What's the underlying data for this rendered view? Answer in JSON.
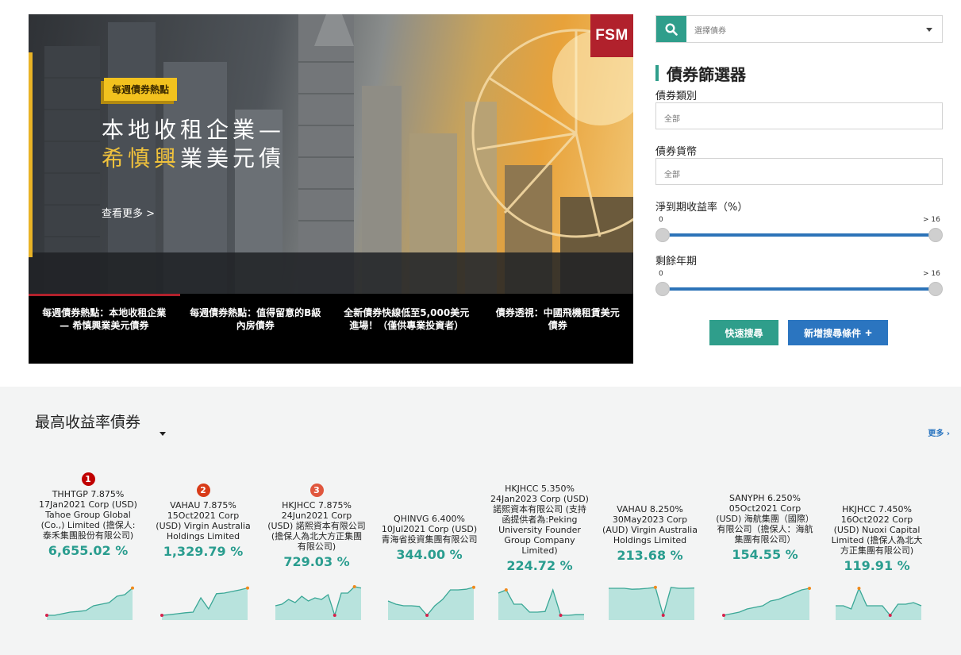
{
  "hero": {
    "logo": "FSM",
    "tag": "每週債券熱點",
    "title_line1": "本地收租企業—",
    "title_line2_a": "希慎興",
    "title_line2_b": "業",
    "title_line2_c": "美元債",
    "more": "查看更多 >",
    "nav": [
      "每週債券熱點：本地收租企業 — 希慎興業美元債券",
      "每週債券熱點：值得留意的B級內房債券",
      "全新債券快線低至5,000美元進場！（僅供專業投資者）",
      "債券透視：中國飛機租賃美元債券"
    ]
  },
  "search": {
    "placeholder": "選擇債券",
    "icon": "search-icon"
  },
  "filter": {
    "title": "債券篩選器",
    "type_label": "債券類別",
    "type_value": "全部",
    "currency_label": "債券貨幣",
    "currency_value": "全部",
    "ytm_label": "淨到期收益率（%）",
    "ytm_min": "0",
    "ytm_max": "> 16",
    "tenor_label": "剩餘年期",
    "tenor_min": "0",
    "tenor_max": "> 16",
    "quick_search": "快速搜尋",
    "add_condition": "新增搜尋條件",
    "add_icon": "+"
  },
  "section": {
    "title": "最高收益率債券",
    "more": "更多",
    "more_icon": "›"
  },
  "colors": {
    "teal": "#2f9e8b",
    "blue": "#2b75c0",
    "rank1": "#c00000",
    "rank2": "#d83b18",
    "rank3": "#e0563d"
  },
  "bonds": [
    {
      "rank": "1",
      "name": "THHTGP 7.875% 17Jan2021 Corp (USD) Tahoe Group Global (Co.,) Limited (擔保人:泰禾集團股份有限公司)",
      "yield": "6,655.02 %",
      "spark": [
        1,
        1,
        1.5,
        2,
        2.2,
        2.5,
        4,
        4.5,
        5,
        7,
        7.5,
        9.6
      ]
    },
    {
      "rank": "2",
      "name": "VAHAU 7.875% 15Oct2021 Corp (USD) Virgin Australia Holdings Limited",
      "yield": "1,329.79 %",
      "spark": [
        1,
        1.2,
        1.5,
        1.8,
        2,
        6.5,
        3,
        7.8,
        8,
        8.5,
        9,
        9.6
      ]
    },
    {
      "rank": "3",
      "name": "HKJHCC 7.875% 24Jun2021 Corp (USD) 諾熙資本有限公司 (擔保人為北大方正集團有限公司)",
      "yield": "729.03 %",
      "spark": [
        4,
        4.5,
        6,
        5,
        7,
        5.5,
        6.5,
        6,
        7.5,
        1,
        8,
        8,
        10,
        9.6
      ]
    },
    {
      "rank": "",
      "name": "QHINVG 6.400% 10Jul2021 Corp (USD) 青海省投資集團有限公司",
      "yield": "344.00 %",
      "spark": [
        5.5,
        4.5,
        4,
        4,
        3.8,
        1,
        4,
        6,
        9,
        9,
        9.2,
        9.8
      ]
    },
    {
      "rank": "",
      "name": "HKJHCC 5.350% 24Jan2023 Corp (USD) 諾熙資本有限公司 (支持函提供者為:Peking University Founder Group Company Limited)",
      "yield": "224.72 %",
      "spark": [
        8,
        9,
        4.5,
        4.5,
        2,
        2,
        2.2,
        9,
        1,
        1,
        1.2,
        1.2
      ]
    },
    {
      "rank": "",
      "name": "VAHAU 8.250% 30May2023 Corp (AUD) Virgin Australia Holdings Limited",
      "yield": "213.68 %",
      "spark": [
        9.5,
        9.5,
        9.5,
        9.2,
        9.3,
        9.5,
        9.8,
        1,
        9.8,
        9.5,
        9.5,
        9.6
      ]
    },
    {
      "rank": "",
      "name": "SANYPH 6.250% 05Oct2021 Corp (USD) 海航集團（國際）有限公司（擔保人：海航集團有限公司）",
      "yield": "154.55 %",
      "spark": [
        1,
        1.5,
        2,
        3,
        3.5,
        4,
        5.5,
        6,
        7,
        8,
        9,
        9.5
      ]
    },
    {
      "rank": "",
      "name": "HKJHCC 7.450% 16Oct2022 Corp (USD) Nuoxi Capital Limited (擔保人為北大方正集團有限公司)",
      "yield": "119.91 %",
      "spark": [
        4,
        4,
        3,
        9.5,
        4,
        4,
        4,
        1,
        4.5,
        4.5,
        5,
        4
      ]
    }
  ]
}
